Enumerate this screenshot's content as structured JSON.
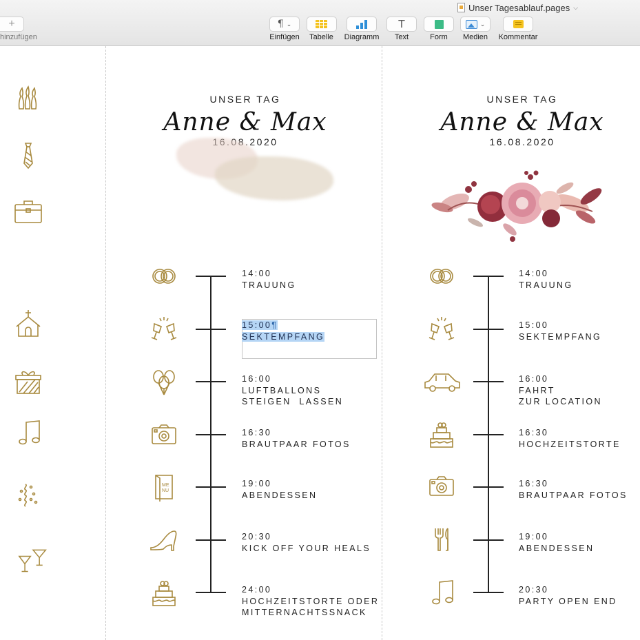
{
  "toolbar": {
    "add_label": "hinzufügen",
    "document_title": "Unser Tagesablauf.pages",
    "tools": [
      {
        "id": "insert",
        "label": "Einfügen",
        "icon": "paragraph-icon"
      },
      {
        "id": "table",
        "label": "Tabelle",
        "icon": "table-icon"
      },
      {
        "id": "chart",
        "label": "Diagramm",
        "icon": "chart-icon"
      },
      {
        "id": "text",
        "label": "Text",
        "icon": "text-icon"
      },
      {
        "id": "shape",
        "label": "Form",
        "icon": "shape-icon"
      },
      {
        "id": "media",
        "label": "Medien",
        "icon": "media-icon"
      },
      {
        "id": "comment",
        "label": "Kommentar",
        "icon": "comment-icon"
      }
    ]
  },
  "colors": {
    "gold": "#a88a3f",
    "selection": "#b5d5f5",
    "line": "#222222"
  },
  "sidebar_icons": [
    "bowling-pins-icon",
    "tie-icon",
    "suitcase-icon",
    "church-icon",
    "gift-icon",
    "music-note-icon",
    "confetti-icon",
    "cocktail-glasses-icon"
  ],
  "left_page": {
    "header": {
      "subtitle": "UNSER TAG",
      "names": "Anne & Max",
      "date": "16.08.2020"
    },
    "entries": [
      {
        "time": "14:00",
        "lines": [
          "TRAUUNG"
        ],
        "icon": "rings-icon"
      },
      {
        "time": "15:00",
        "lines": [
          "SEKTEMPFANG"
        ],
        "icon": "champagne-toast-icon",
        "selected": true
      },
      {
        "time": "16:00",
        "lines": [
          "LUFTBALLONS",
          "STEIGEN  LASSEN"
        ],
        "icon": "balloons-icon"
      },
      {
        "time": "16:30",
        "lines": [
          "BRAUTPAAR FOTOS"
        ],
        "icon": "camera-icon"
      },
      {
        "time": "19:00",
        "lines": [
          "ABENDESSEN"
        ],
        "icon": "menu-card-icon"
      },
      {
        "time": "20:30",
        "lines": [
          "KICK OFF YOUR HEALS"
        ],
        "icon": "high-heel-icon"
      },
      {
        "time": "24:00",
        "lines": [
          "HOCHZEITSTORTE ODER",
          "MITTERNACHTSSNACK"
        ],
        "icon": "cake-icon"
      }
    ],
    "menu_icon_text": "ME NU"
  },
  "right_page": {
    "header": {
      "subtitle": "UNSER TAG",
      "names": "Anne & Max",
      "date": "16.08.2020"
    },
    "entries": [
      {
        "time": "14:00",
        "lines": [
          "TRAUUNG"
        ],
        "icon": "rings-icon"
      },
      {
        "time": "15:00",
        "lines": [
          "SEKTEMPFANG"
        ],
        "icon": "champagne-toast-icon"
      },
      {
        "time": "16:00",
        "lines": [
          "FAHRT",
          "ZUR LOCATION"
        ],
        "icon": "car-icon"
      },
      {
        "time": "16:30",
        "lines": [
          "HOCHZEITSTORTE"
        ],
        "icon": "cake-icon"
      },
      {
        "time": "16:30",
        "lines": [
          "BRAUTPAAR FOTOS"
        ],
        "icon": "camera-icon"
      },
      {
        "time": "19:00",
        "lines": [
          "ABENDESSEN"
        ],
        "icon": "cutlery-icon"
      },
      {
        "time": "20:30",
        "lines": [
          "PARTY OPEN END"
        ],
        "icon": "music-note-icon"
      }
    ]
  },
  "selection": {
    "pilcrow": "¶"
  }
}
